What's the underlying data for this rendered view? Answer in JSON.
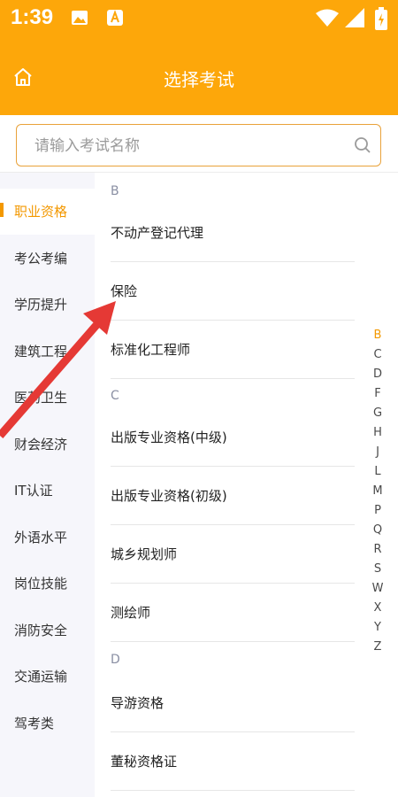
{
  "status_bar": {
    "time": "1:39"
  },
  "header": {
    "title": "选择考试"
  },
  "search": {
    "placeholder": "请输入考试名称"
  },
  "sidebar": {
    "items": [
      {
        "label": "职业资格",
        "active": true
      },
      {
        "label": "考公考编"
      },
      {
        "label": "学历提升"
      },
      {
        "label": "建筑工程"
      },
      {
        "label": "医药卫生"
      },
      {
        "label": "财会经济"
      },
      {
        "label": "IT认证"
      },
      {
        "label": "外语水平"
      },
      {
        "label": "岗位技能"
      },
      {
        "label": "消防安全"
      },
      {
        "label": "交通运输"
      },
      {
        "label": "驾考类"
      }
    ]
  },
  "sections": [
    {
      "letter": "B",
      "items": [
        "不动产登记代理",
        "保险",
        "标准化工程师"
      ]
    },
    {
      "letter": "C",
      "items": [
        "出版专业资格(中级)",
        "出版专业资格(初级)",
        "城乡规划师",
        "测绘师"
      ]
    },
    {
      "letter": "D",
      "items": [
        "导游资格",
        "董秘资格证"
      ]
    }
  ],
  "alpha_index": [
    "B",
    "C",
    "D",
    "F",
    "G",
    "H",
    "J",
    "L",
    "M",
    "P",
    "Q",
    "R",
    "S",
    "W",
    "X",
    "Y",
    "Z"
  ],
  "colors": {
    "accent": "#FDA70A",
    "active_text": "#F39800",
    "annotation_arrow": "#E53935"
  }
}
